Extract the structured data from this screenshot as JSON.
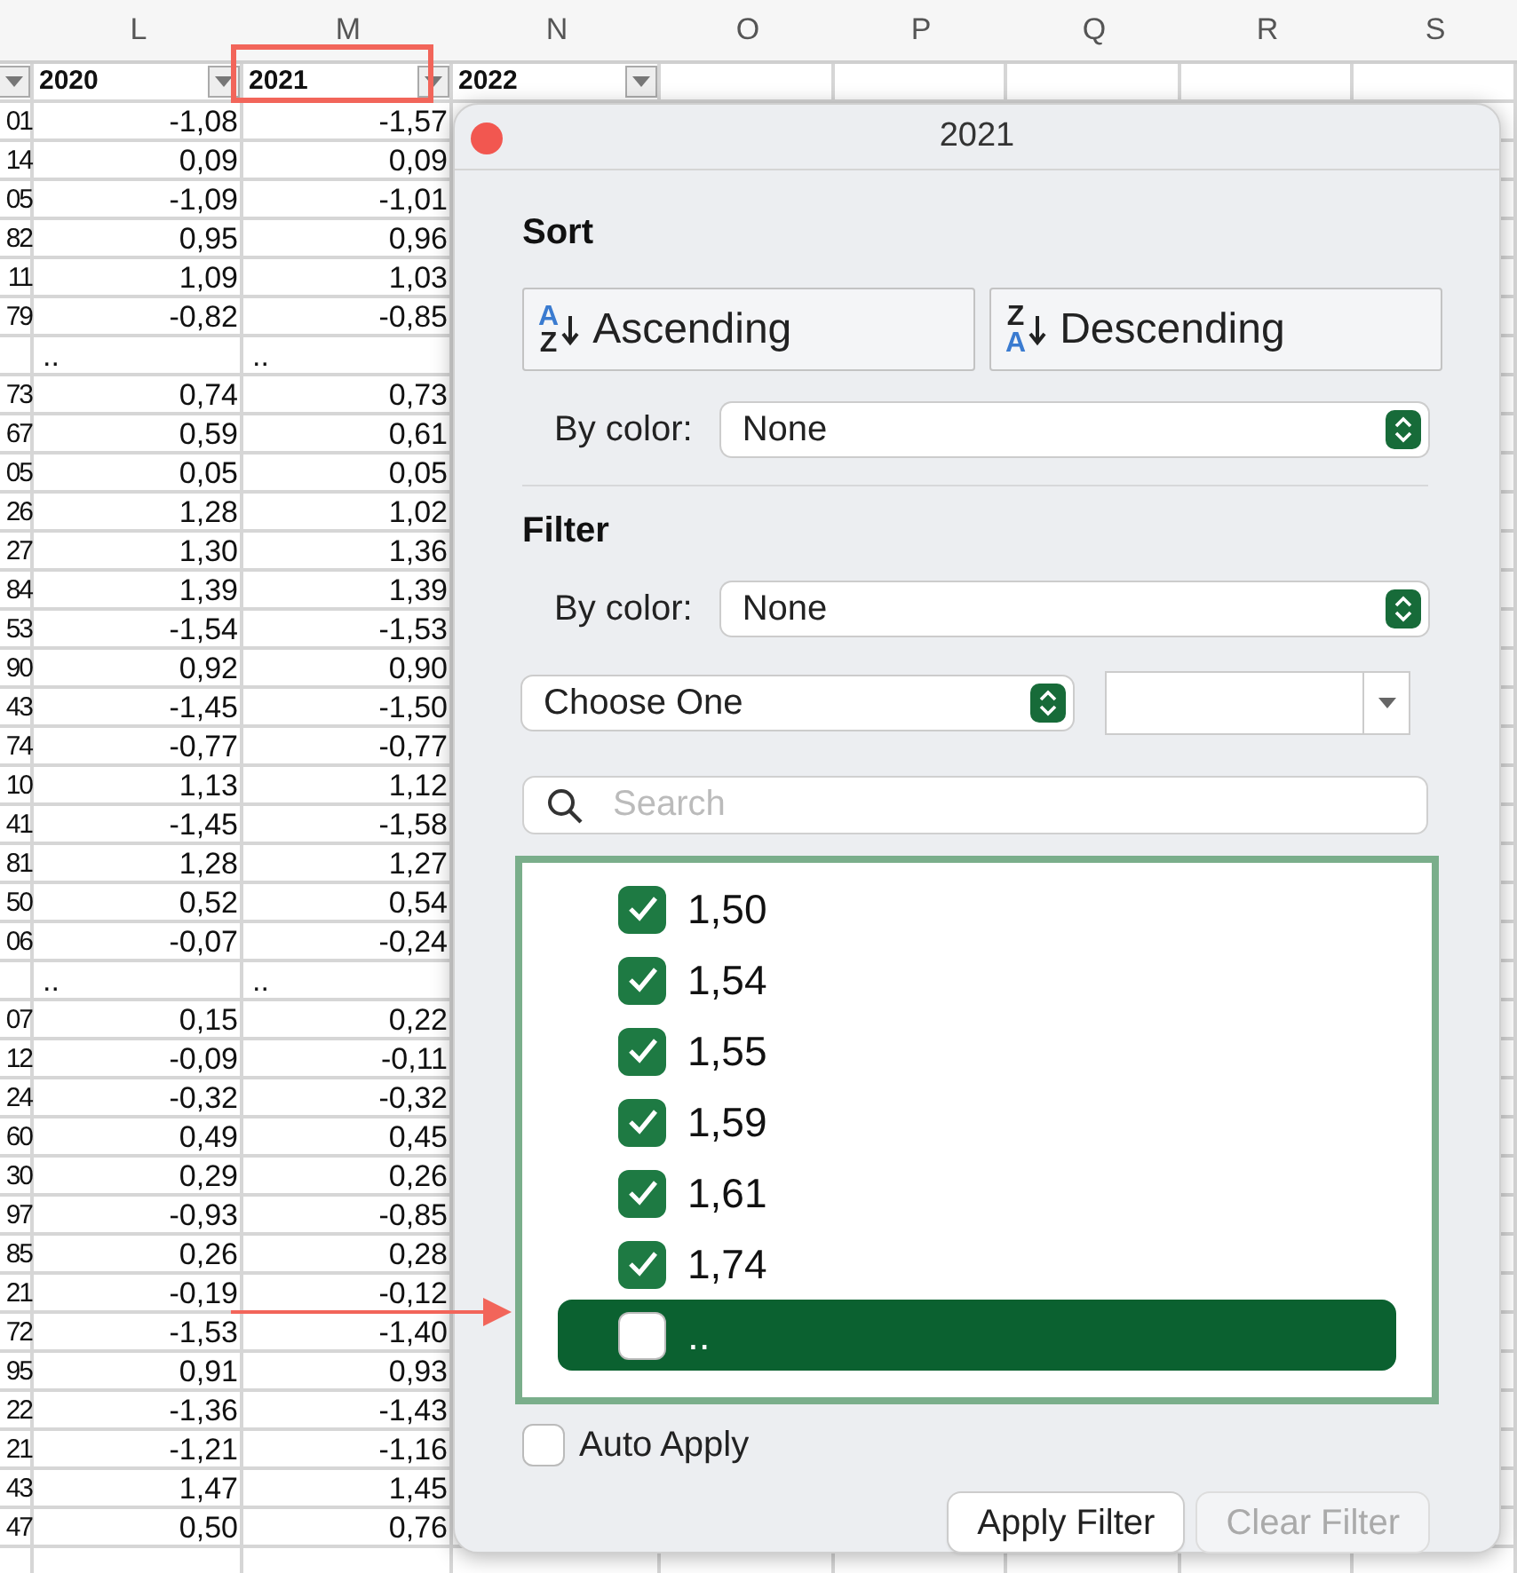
{
  "sheet": {
    "column_letters": [
      "L",
      "M",
      "N",
      "O",
      "P",
      "Q",
      "R",
      "S"
    ],
    "header_cells": [
      {
        "text": "2020",
        "filter": true
      },
      {
        "text": "2021",
        "filter": true
      },
      {
        "text": "2022",
        "filter": true
      }
    ],
    "rows": [
      {
        "k": "01",
        "l": "-1,08",
        "m": "-1,57"
      },
      {
        "k": "14",
        "l": "0,09",
        "m": "0,09"
      },
      {
        "k": "05",
        "l": "-1,09",
        "m": "-1,01"
      },
      {
        "k": "82",
        "l": "0,95",
        "m": "0,96"
      },
      {
        "k": "11",
        "l": "1,09",
        "m": "1,03"
      },
      {
        "k": "79",
        "l": "-0,82",
        "m": "-0,85"
      },
      {
        "l": "..",
        "m": ".."
      },
      {
        "k": "73",
        "l": "0,74",
        "m": "0,73"
      },
      {
        "k": "67",
        "l": "0,59",
        "m": "0,61"
      },
      {
        "k": "05",
        "l": "0,05",
        "m": "0,05"
      },
      {
        "k": "26",
        "l": "1,28",
        "m": "1,02"
      },
      {
        "k": "27",
        "l": "1,30",
        "m": "1,36"
      },
      {
        "k": "84",
        "l": "1,39",
        "m": "1,39"
      },
      {
        "k": "53",
        "l": "-1,54",
        "m": "-1,53"
      },
      {
        "k": "90",
        "l": "0,92",
        "m": "0,90"
      },
      {
        "k": "43",
        "l": "-1,45",
        "m": "-1,50"
      },
      {
        "k": "74",
        "l": "-0,77",
        "m": "-0,77"
      },
      {
        "k": "10",
        "l": "1,13",
        "m": "1,12"
      },
      {
        "k": "41",
        "l": "-1,45",
        "m": "-1,58"
      },
      {
        "k": "81",
        "l": "1,28",
        "m": "1,27"
      },
      {
        "k": "50",
        "l": "0,52",
        "m": "0,54"
      },
      {
        "k": "06",
        "l": "-0,07",
        "m": "-0,24"
      },
      {
        "l": "..",
        "m": ".."
      },
      {
        "k": "07",
        "l": "0,15",
        "m": "0,22"
      },
      {
        "k": "12",
        "l": "-0,09",
        "m": "-0,11"
      },
      {
        "k": "24",
        "l": "-0,32",
        "m": "-0,32"
      },
      {
        "k": "60",
        "l": "0,49",
        "m": "0,45"
      },
      {
        "k": "30",
        "l": "0,29",
        "m": "0,26"
      },
      {
        "k": "97",
        "l": "-0,93",
        "m": "-0,85"
      },
      {
        "k": "85",
        "l": "0,26",
        "m": "0,28"
      },
      {
        "k": "21",
        "l": "-0,19",
        "m": "-0,12"
      },
      {
        "k": "72",
        "l": "-1,53",
        "m": "-1,40"
      },
      {
        "k": "95",
        "l": "0,91",
        "m": "0,93"
      },
      {
        "k": "22",
        "l": "-1,36",
        "m": "-1,43"
      },
      {
        "k": "21",
        "l": "-1,21",
        "m": "-1,16"
      },
      {
        "k": "43",
        "l": "1,47",
        "m": "1,45"
      },
      {
        "k": "47",
        "l": "0,50",
        "m": "0,76"
      }
    ]
  },
  "annotations": [
    {
      "kind": "rectangle"
    },
    {
      "kind": "arrow"
    }
  ],
  "popup": {
    "title": "2021",
    "sort": {
      "heading": "Sort",
      "buttons": [
        {
          "kind": "ascending",
          "icon_letters": [
            "A",
            "Z"
          ],
          "label": "Ascending"
        },
        {
          "kind": "descending",
          "icon_letters": [
            "Z",
            "A"
          ],
          "label": "Descending"
        }
      ],
      "by_color_label": "By color:",
      "by_color_value": "None"
    },
    "filter": {
      "heading": "Filter",
      "by_color_label": "By color:",
      "by_color_value": "None",
      "condition": "Choose One",
      "search_placeholder": "Search",
      "items": [
        {
          "label": "1,50",
          "checked": true,
          "selected": false
        },
        {
          "label": "1,54",
          "checked": true,
          "selected": false
        },
        {
          "label": "1,55",
          "checked": true,
          "selected": false
        },
        {
          "label": "1,59",
          "checked": true,
          "selected": false
        },
        {
          "label": "1,61",
          "checked": true,
          "selected": false
        },
        {
          "label": "1,74",
          "checked": true,
          "selected": false
        },
        {
          "label": "..",
          "checked": false,
          "selected": true
        }
      ]
    },
    "auto_apply": {
      "label": "Auto Apply",
      "checked": false
    },
    "buttons": [
      {
        "label": "Apply Filter",
        "disabled": false
      },
      {
        "label": "Clear Filter",
        "disabled": true
      }
    ]
  }
}
